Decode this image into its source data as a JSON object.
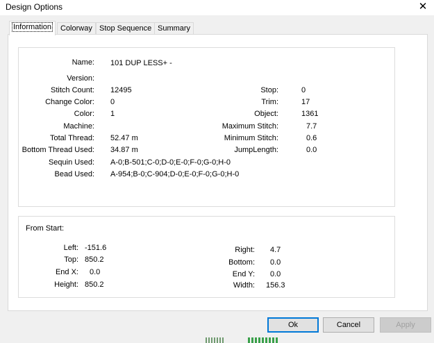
{
  "window": {
    "title": "Design Options",
    "close_glyph": "✕"
  },
  "tabs": [
    {
      "label": "Information"
    },
    {
      "label": "Colorway"
    },
    {
      "label": "Stop Sequence"
    },
    {
      "label": "Summary"
    }
  ],
  "info": {
    "name_label": "Name:",
    "name_value": "101 DUP LESS+ -",
    "version_label": "Version:",
    "version_value": "",
    "stitch_count_label": "Stitch Count:",
    "stitch_count_value": "12495",
    "change_color_label": "Change Color:",
    "change_color_value": "0",
    "color_label": "Color:",
    "color_value": "1",
    "machine_label": "Machine:",
    "machine_value": "",
    "total_thread_label": "Total Thread:",
    "total_thread_value": "52.47 m",
    "bottom_thread_label": "Bottom Thread Used:",
    "bottom_thread_value": "34.87 m",
    "sequin_label": "Sequin Used:",
    "sequin_value": "A-0;B-501;C-0;D-0;E-0;F-0;G-0;H-0",
    "bead_label": "Bead Used:",
    "bead_value": "A-954;B-0;C-904;D-0;E-0;F-0;G-0;H-0",
    "stop_label": "Stop:",
    "stop_value": "0",
    "trim_label": "Trim:",
    "trim_value": "17",
    "object_label": "Object:",
    "object_value": "1361",
    "max_stitch_label": "Maximum Stitch:",
    "max_stitch_value": "7.7",
    "min_stitch_label": "Minimum Stitch:",
    "min_stitch_value": "0.6",
    "jump_length_label": "JumpLength:",
    "jump_length_value": "0.0"
  },
  "from_start": {
    "heading": "From Start:",
    "left_label": "Left:",
    "left_value": "-151.6",
    "top_label": "Top:",
    "top_value": "850.2",
    "endx_label": "End X:",
    "endx_value": "0.0",
    "height_label": "Height:",
    "height_value": "850.2",
    "right_label": "Right:",
    "right_value": "4.7",
    "bottom_label": "Bottom:",
    "bottom_value": "0.0",
    "endy_label": "End Y:",
    "endy_value": "0.0",
    "width_label": "Width:",
    "width_value": "156.3"
  },
  "buttons": {
    "ok": "Ok",
    "cancel": "Cancel",
    "apply": "Apply"
  },
  "colors": {
    "focus": "#0078d7",
    "border": "#d9d9d9",
    "disabled_text": "#a0a0a0"
  }
}
